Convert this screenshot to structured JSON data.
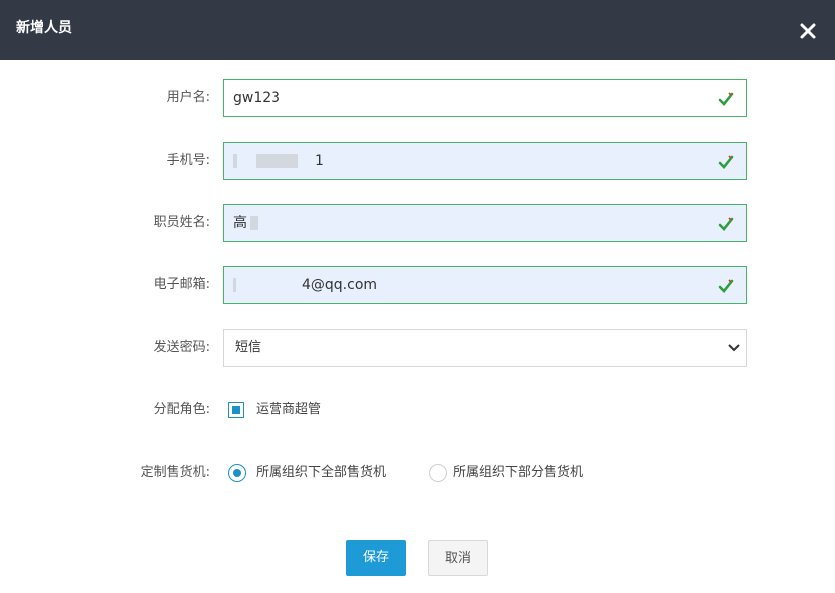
{
  "dialog": {
    "title": "新增人员"
  },
  "form": {
    "username": {
      "label": "用户名:",
      "value": "gw123"
    },
    "phone": {
      "label": "手机号:",
      "value": "1"
    },
    "name": {
      "label": "职员姓名:",
      "value": "高"
    },
    "email": {
      "label": "电子邮箱:",
      "value": "4@qq.com"
    },
    "send_password": {
      "label": "发送密码:",
      "selected": "短信"
    },
    "role": {
      "label": "分配角色:",
      "option": "运营商超管"
    },
    "vending": {
      "label": "定制售货机:",
      "options": [
        "所属组织下全部售货机",
        "所属组织下部分售货机"
      ],
      "selected_index": 0
    }
  },
  "actions": {
    "save": "保存",
    "cancel": "取消"
  },
  "colors": {
    "header_bg": "#343a45",
    "valid_border": "#47b36a",
    "primary": "#1e9ad6",
    "accent": "#1e90c8"
  },
  "icons": [
    "close-icon",
    "valid-check-icon",
    "chevron-down-icon"
  ]
}
